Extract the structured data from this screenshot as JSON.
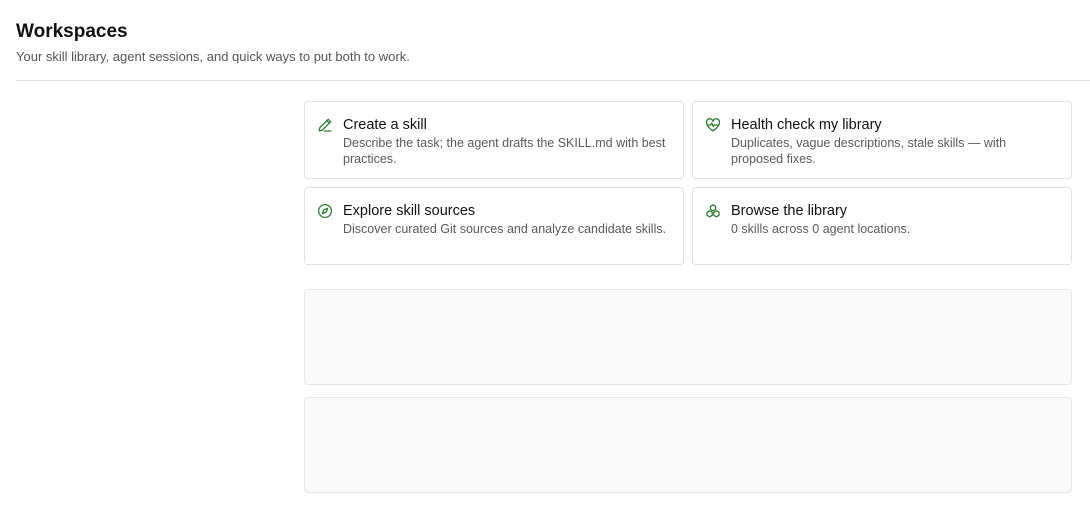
{
  "page": {
    "title": "Workspaces",
    "subtitle": "Your skill library, agent sessions, and quick ways to put both to work."
  },
  "accent_color": "#2e7d32",
  "cards": [
    {
      "title": "Create a skill",
      "description": "Describe the task; the agent drafts the SKILL.md with best practices.",
      "icon": "pencil-icon"
    },
    {
      "title": "Health check my library",
      "description": "Duplicates, vague descriptions, stale skills — with proposed fixes.",
      "icon": "heart-pulse-icon"
    },
    {
      "title": "Explore skill sources",
      "description": "Discover curated Git sources and analyze candidate skills.",
      "icon": "compass-icon"
    },
    {
      "title": "Browse the library",
      "description": "0 skills across 0 agent locations.",
      "icon": "library-icon"
    }
  ]
}
